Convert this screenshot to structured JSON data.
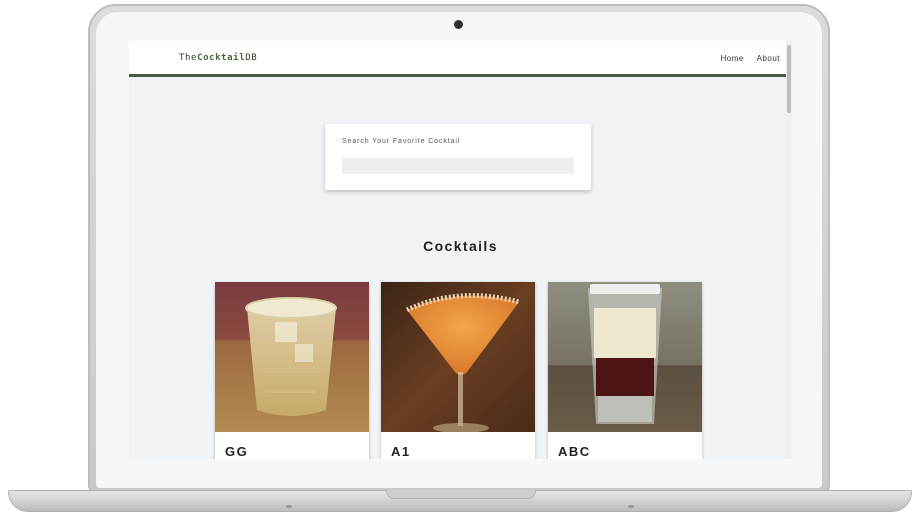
{
  "navbar": {
    "brand_part1": "The",
    "brand_part2": "Cocktail",
    "brand_part3": "DB",
    "links": [
      "Home",
      "About"
    ]
  },
  "search": {
    "label": "Search Your Favorite Cocktail",
    "placeholder": "",
    "value": ""
  },
  "section": {
    "title": "Cocktails"
  },
  "cocktails": [
    {
      "name": "GG",
      "image": "gg-cocktail-photo"
    },
    {
      "name": "A1",
      "image": "a1-cocktail-photo"
    },
    {
      "name": "ABC",
      "image": "abc-cocktail-photo"
    }
  ],
  "colors": {
    "accent": "#4b5a45",
    "brand_green": "#3f6a33",
    "page_background": "#f0f3f6",
    "card_background": "#ffffff"
  }
}
